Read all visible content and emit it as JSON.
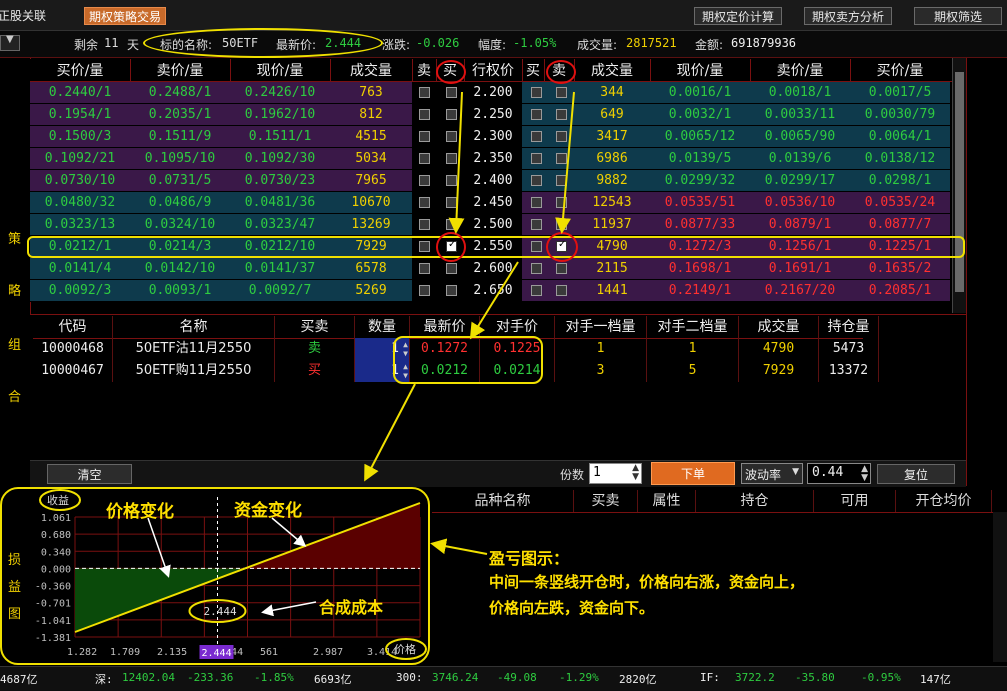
{
  "topbar": {
    "tabs": [
      "正股关联",
      "期权策略交易"
    ],
    "buttons": [
      "期权定价计算",
      "期权卖方分析",
      "期权筛选"
    ]
  },
  "infobar": {
    "remaining_label": "剩余",
    "remaining_days": "11",
    "remaining_unit": "天",
    "underlying_label": "标的名称:",
    "underlying_name": "50ETF",
    "last_label": "最新价:",
    "last_price": "2.444",
    "change_label": "涨跌:",
    "change": "-0.026",
    "pct_label": "幅度:",
    "pct": "-1.05%",
    "volume_label": "成交量:",
    "volume": "2817521",
    "amount_label": "金额:",
    "amount": "691879936"
  },
  "chain": {
    "headers_left": [
      "买价/量",
      "卖价/量",
      "现价/量",
      "成交量",
      "卖",
      "买"
    ],
    "header_strike": "行权价",
    "headers_right": [
      "买",
      "卖",
      "成交量",
      "现价/量",
      "卖价/量",
      "买价/量"
    ],
    "rows": [
      {
        "cbid": "0.2440/1",
        "cask": "0.2488/1",
        "clast": "0.2426/10",
        "cvol": "763",
        "csell": false,
        "cbuy": false,
        "strike": "2.200",
        "pbuy": false,
        "psell": false,
        "pvol": "344",
        "plast": "0.0016/1",
        "pask": "0.0018/1",
        "pbid": "0.0017/5"
      },
      {
        "cbid": "0.1954/1",
        "cask": "0.2035/1",
        "clast": "0.1962/10",
        "cvol": "812",
        "csell": false,
        "cbuy": false,
        "strike": "2.250",
        "pbuy": false,
        "psell": false,
        "pvol": "649",
        "plast": "0.0032/1",
        "pask": "0.0033/11",
        "pbid": "0.0030/79"
      },
      {
        "cbid": "0.1500/3",
        "cask": "0.1511/9",
        "clast": "0.1511/1",
        "cvol": "4515",
        "csell": false,
        "cbuy": false,
        "strike": "2.300",
        "pbuy": false,
        "psell": false,
        "pvol": "3417",
        "plast": "0.0065/12",
        "pask": "0.0065/90",
        "pbid": "0.0064/1"
      },
      {
        "cbid": "0.1092/21",
        "cask": "0.1095/10",
        "clast": "0.1092/30",
        "cvol": "5034",
        "csell": false,
        "cbuy": false,
        "strike": "2.350",
        "pbuy": false,
        "psell": false,
        "pvol": "6986",
        "plast": "0.0139/5",
        "pask": "0.0139/6",
        "pbid": "0.0138/12"
      },
      {
        "cbid": "0.0730/10",
        "cask": "0.0731/5",
        "clast": "0.0730/23",
        "cvol": "7965",
        "csell": false,
        "cbuy": false,
        "strike": "2.400",
        "pbuy": false,
        "psell": false,
        "pvol": "9882",
        "plast": "0.0299/32",
        "pask": "0.0299/17",
        "pbid": "0.0298/1"
      },
      {
        "cbid": "0.0480/32",
        "cask": "0.0486/9",
        "clast": "0.0481/36",
        "cvol": "10670",
        "csell": false,
        "cbuy": false,
        "strike": "2.450",
        "pbuy": false,
        "psell": false,
        "pvol": "12543",
        "plast": "0.0535/51",
        "pask": "0.0536/10",
        "pbid": "0.0535/24"
      },
      {
        "cbid": "0.0323/13",
        "cask": "0.0324/10",
        "clast": "0.0323/47",
        "cvol": "13269",
        "csell": false,
        "cbuy": false,
        "strike": "2.500",
        "pbuy": false,
        "psell": false,
        "pvol": "11937",
        "plast": "0.0877/33",
        "pask": "0.0879/1",
        "pbid": "0.0877/7"
      },
      {
        "cbid": "0.0212/1",
        "cask": "0.0214/3",
        "clast": "0.0212/10",
        "cvol": "7929",
        "csell": false,
        "cbuy": true,
        "strike": "2.550",
        "pbuy": false,
        "psell": true,
        "pvol": "4790",
        "plast": "0.1272/3",
        "pask": "0.1256/1",
        "pbid": "0.1225/1"
      },
      {
        "cbid": "0.0141/4",
        "cask": "0.0142/10",
        "clast": "0.0141/37",
        "cvol": "6578",
        "csell": false,
        "cbuy": false,
        "strike": "2.600",
        "pbuy": false,
        "psell": false,
        "pvol": "2115",
        "plast": "0.1698/1",
        "pask": "0.1691/1",
        "pbid": "0.1635/2"
      },
      {
        "cbid": "0.0092/3",
        "cask": "0.0093/1",
        "clast": "0.0092/7",
        "cvol": "5269",
        "csell": false,
        "cbuy": false,
        "strike": "2.650",
        "pbuy": false,
        "psell": false,
        "pvol": "1441",
        "plast": "0.2149/1",
        "pask": "0.2167/20",
        "pbid": "0.2085/1"
      }
    ]
  },
  "side_label": [
    "策",
    "略",
    "组",
    "合"
  ],
  "side_label2": [
    "损",
    "益",
    "图"
  ],
  "combo": {
    "headers": [
      "代码",
      "名称",
      "买卖",
      "数量",
      "最新价",
      "对手价",
      "对手一档量",
      "对手二档量",
      "成交量",
      "持仓量"
    ],
    "rows": [
      {
        "code": "10000468",
        "name": "50ETF沽11月2550",
        "side": "卖",
        "qty": "1",
        "last": "0.1272",
        "opp": "0.1225",
        "opp1": "1",
        "opp2": "1",
        "vol": "4790",
        "oi": "5473"
      },
      {
        "code": "10000467",
        "name": "50ETF购11月2550",
        "side": "买",
        "qty": "1",
        "last": "0.0212",
        "opp": "0.0214",
        "opp1": "3",
        "opp2": "5",
        "vol": "7929",
        "oi": "13372"
      }
    ]
  },
  "controls": {
    "clear": "清空",
    "lots_label": "份数",
    "lots": "1",
    "order": "下单",
    "vol_select": "波动率",
    "vol_value": "0.44",
    "reset": "复位"
  },
  "positions": {
    "headers": [
      "品种名称",
      "买卖",
      "属性",
      "持仓",
      "可用",
      "开仓均价"
    ]
  },
  "pnl_chart": {
    "y_label": "收益",
    "x_label": "价格",
    "y_ticks": [
      "1.061",
      "0.680",
      "0.340",
      "0.000",
      "-0.360",
      "-0.701",
      "-1.041",
      "-1.381"
    ],
    "x_ticks": [
      "1.282",
      "1.709",
      "2.135",
      "2.444",
      "561",
      "2.987",
      "3.414"
    ],
    "cost_label": "2.444",
    "current_price": "2.444"
  },
  "annotations": {
    "price_change": "价格变化",
    "capital_change": "资金变化",
    "synthetic_cost": "合成成本",
    "pnl_title": "盈亏图示：",
    "pnl_line1": "中间一条竖线开仓时，价格向右涨，资金向上，",
    "pnl_line2": "价格向左跌，资金向下。"
  },
  "statusbar": {
    "items": [
      "4687亿",
      "深:",
      "12402.04",
      "-233.36",
      "-1.85%",
      "6693亿",
      "300:",
      "3746.24",
      "-49.08",
      "-1.29%",
      "2820亿",
      "IF:",
      "3722.2",
      "-35.80",
      "-0.95%",
      "147亿"
    ]
  },
  "colors": {
    "purple_row": "#3a1848",
    "teal_row": "#0e3a4c",
    "grid_red": "#7a1010",
    "annot_yellow": "#ffe000",
    "profit_red": "#5a0000",
    "loss_green": "#0a4a0a"
  }
}
